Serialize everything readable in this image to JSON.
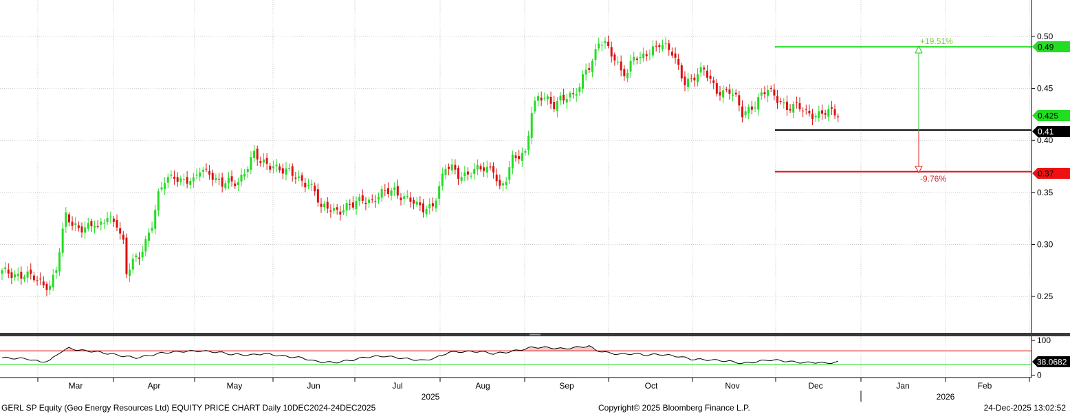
{
  "chart_data": {
    "type": "candlestick",
    "price_axis": {
      "ylim": [
        0.215,
        0.535
      ],
      "ticks": [
        "0.25",
        "0.30",
        "0.35",
        "0.40",
        "0.45",
        "0.50"
      ]
    },
    "rsi_axis": {
      "ylim": [
        -5,
        112
      ],
      "ticks": [
        "100",
        "0"
      ],
      "upper_line": 70,
      "lower_line": 30,
      "current_label": "38.0682",
      "current_value": 38.07
    },
    "x_axis": {
      "months": [
        "Mar",
        "Apr",
        "May",
        "Jun",
        "Jul",
        "Aug",
        "Sep",
        "Oct",
        "Nov",
        "Dec",
        "Jan",
        "Feb"
      ],
      "years": [
        "2025",
        "2026"
      ]
    },
    "levels": [
      {
        "name": "upper target",
        "value": 0.49,
        "label": "0.49",
        "color": "#22dd22"
      },
      {
        "name": "current",
        "value": 0.425,
        "label": "0.425",
        "color": "#22dd22"
      },
      {
        "name": "reference",
        "value": 0.41,
        "label": "0.41",
        "color": "#000000"
      },
      {
        "name": "lower target",
        "value": 0.37,
        "label": "0.37",
        "color": "#dd1111"
      }
    ],
    "annotations": {
      "up_pct": "+19.51%",
      "down_pct": "-9.76%"
    },
    "waypoints": [
      [
        0,
        0.272
      ],
      [
        7,
        0.272
      ],
      [
        9,
        0.268
      ],
      [
        12,
        0.262
      ],
      [
        15,
        0.262
      ],
      [
        17,
        0.278
      ],
      [
        20,
        0.326
      ],
      [
        22,
        0.318
      ],
      [
        25,
        0.318
      ],
      [
        29,
        0.318
      ],
      [
        30,
        0.312
      ],
      [
        33,
        0.328
      ],
      [
        36,
        0.322
      ],
      [
        38,
        0.3
      ],
      [
        39,
        0.27
      ],
      [
        41,
        0.282
      ],
      [
        43,
        0.29
      ],
      [
        47,
        0.32
      ],
      [
        49,
        0.345
      ],
      [
        51,
        0.36
      ],
      [
        54,
        0.368
      ],
      [
        56,
        0.363
      ],
      [
        60,
        0.358
      ],
      [
        62,
        0.372
      ],
      [
        65,
        0.372
      ],
      [
        67,
        0.362
      ],
      [
        69,
        0.356
      ],
      [
        74,
        0.362
      ],
      [
        77,
        0.376
      ],
      [
        79,
        0.385
      ],
      [
        81,
        0.378
      ],
      [
        85,
        0.378
      ],
      [
        88,
        0.37
      ],
      [
        92,
        0.365
      ],
      [
        96,
        0.36
      ],
      [
        98,
        0.35
      ],
      [
        100,
        0.332
      ],
      [
        102,
        0.336
      ],
      [
        106,
        0.334
      ],
      [
        108,
        0.335
      ],
      [
        110,
        0.336
      ],
      [
        113,
        0.345
      ],
      [
        116,
        0.343
      ],
      [
        121,
        0.35
      ],
      [
        123,
        0.353
      ],
      [
        128,
        0.342
      ],
      [
        130,
        0.335
      ],
      [
        132,
        0.334
      ],
      [
        135,
        0.34
      ],
      [
        137,
        0.355
      ],
      [
        139,
        0.372
      ],
      [
        141,
        0.372
      ],
      [
        143,
        0.368
      ],
      [
        148,
        0.37
      ],
      [
        152,
        0.372
      ],
      [
        154,
        0.375
      ],
      [
        156,
        0.355
      ],
      [
        158,
        0.362
      ],
      [
        160,
        0.38
      ],
      [
        162,
        0.385
      ],
      [
        164,
        0.39
      ],
      [
        166,
        0.43
      ],
      [
        168,
        0.44
      ],
      [
        170,
        0.438
      ],
      [
        173,
        0.435
      ],
      [
        175,
        0.443
      ],
      [
        177,
        0.442
      ],
      [
        179,
        0.44
      ],
      [
        181,
        0.45
      ],
      [
        183,
        0.47
      ],
      [
        185,
        0.478
      ],
      [
        187,
        0.495
      ],
      [
        189,
        0.49
      ],
      [
        192,
        0.478
      ],
      [
        194,
        0.47
      ],
      [
        196,
        0.466
      ],
      [
        198,
        0.48
      ],
      [
        200,
        0.475
      ],
      [
        202,
        0.484
      ],
      [
        204,
        0.49
      ],
      [
        206,
        0.495
      ],
      [
        208,
        0.488
      ],
      [
        210,
        0.482
      ],
      [
        212,
        0.47
      ],
      [
        214,
        0.458
      ],
      [
        216,
        0.46
      ],
      [
        218,
        0.462
      ],
      [
        220,
        0.466
      ],
      [
        222,
        0.458
      ],
      [
        224,
        0.45
      ],
      [
        226,
        0.447
      ],
      [
        228,
        0.446
      ],
      [
        230,
        0.438
      ],
      [
        232,
        0.426
      ],
      [
        234,
        0.432
      ],
      [
        236,
        0.436
      ],
      [
        238,
        0.442
      ],
      [
        240,
        0.447
      ],
      [
        242,
        0.443
      ],
      [
        244,
        0.44
      ],
      [
        246,
        0.432
      ],
      [
        248,
        0.431
      ],
      [
        250,
        0.43
      ],
      [
        252,
        0.427
      ],
      [
        254,
        0.427
      ],
      [
        256,
        0.426
      ],
      [
        258,
        0.426
      ],
      [
        260,
        0.425
      ],
      [
        262,
        0.425
      ]
    ],
    "rsi_waypoints": [
      [
        0,
        50
      ],
      [
        8,
        47
      ],
      [
        12,
        38
      ],
      [
        15,
        42
      ],
      [
        18,
        65
      ],
      [
        21,
        78
      ],
      [
        24,
        72
      ],
      [
        30,
        67
      ],
      [
        38,
        55
      ],
      [
        42,
        50
      ],
      [
        46,
        56
      ],
      [
        50,
        64
      ],
      [
        56,
        68
      ],
      [
        62,
        70
      ],
      [
        68,
        66
      ],
      [
        72,
        60
      ],
      [
        78,
        58
      ],
      [
        82,
        62
      ],
      [
        88,
        55
      ],
      [
        94,
        50
      ],
      [
        98,
        40
      ],
      [
        104,
        36
      ],
      [
        110,
        44
      ],
      [
        114,
        52
      ],
      [
        120,
        55
      ],
      [
        126,
        48
      ],
      [
        132,
        42
      ],
      [
        136,
        50
      ],
      [
        140,
        66
      ],
      [
        146,
        68
      ],
      [
        150,
        68
      ],
      [
        154,
        62
      ],
      [
        158,
        66
      ],
      [
        162,
        72
      ],
      [
        166,
        80
      ],
      [
        170,
        80
      ],
      [
        176,
        76
      ],
      [
        180,
        80
      ],
      [
        184,
        84
      ],
      [
        186,
        72
      ],
      [
        190,
        64
      ],
      [
        194,
        60
      ],
      [
        198,
        62
      ],
      [
        202,
        58
      ],
      [
        206,
        60
      ],
      [
        212,
        54
      ],
      [
        216,
        46
      ],
      [
        222,
        44
      ],
      [
        228,
        40
      ],
      [
        232,
        34
      ],
      [
        236,
        38
      ],
      [
        240,
        44
      ],
      [
        244,
        42
      ],
      [
        248,
        38
      ],
      [
        252,
        36
      ],
      [
        256,
        37
      ],
      [
        258,
        34
      ],
      [
        262,
        38
      ]
    ]
  },
  "footer": {
    "left": "GERL SP Equity (Geo Energy Resources Ltd) EQUITY PRICE CHART Daily 10DEC2024-24DEC2025",
    "middle": "Copyright© 2025 Bloomberg Finance L.P.",
    "right": "24-Dec-2025 13:02:52"
  },
  "colors": {
    "up_candle": "#22dd22",
    "down_candle": "#dd1111",
    "grid": "#cccccc",
    "rsi_line": "#000000",
    "rsi_overbought_fill": "#f4cccc"
  }
}
